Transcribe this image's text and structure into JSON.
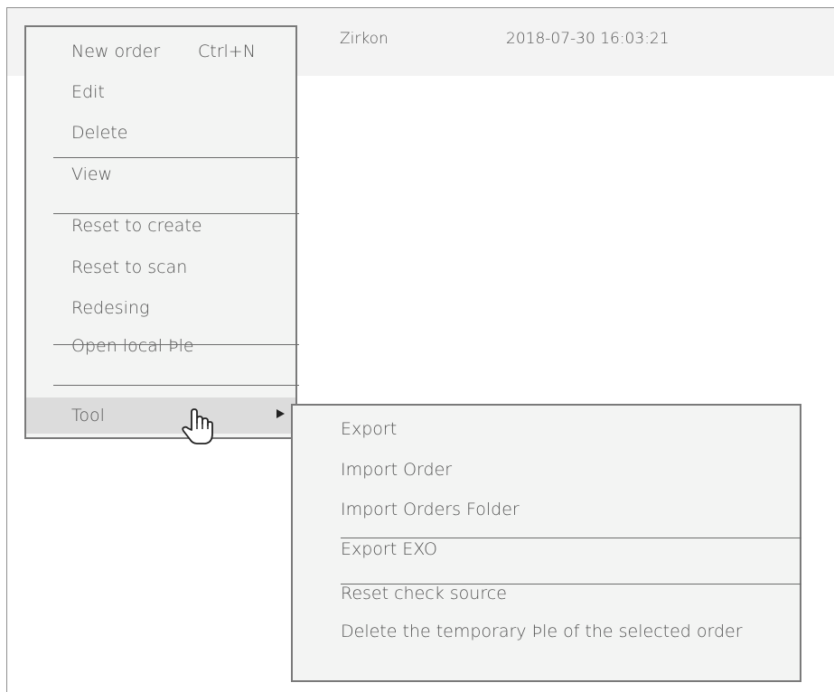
{
  "table_row": {
    "name": "Zirkon",
    "date": "2018-07-30 16:03:21"
  },
  "context_menu": {
    "items": [
      {
        "label": "New order",
        "shortcut": "Ctrl+N"
      },
      {
        "label": "Edit"
      },
      {
        "label": "Delete"
      },
      {
        "label": "View"
      },
      {
        "label": "Reset to create"
      },
      {
        "label": "Reset to scan"
      },
      {
        "label": "Redesing"
      },
      {
        "label": "Open local Þle"
      },
      {
        "label": "Tool",
        "submenu_arrow": "triangle-right-icon"
      }
    ],
    "hovered": "Tool"
  },
  "tool_submenu": {
    "items": [
      {
        "label": "Export"
      },
      {
        "label": "Import Order"
      },
      {
        "label": "Import Orders Folder"
      },
      {
        "label": "Export EXO"
      },
      {
        "label": "Reset check source"
      },
      {
        "label": "Delete the temporary Þle of the selected order"
      }
    ]
  },
  "cursor": "hand-pointer-icon"
}
